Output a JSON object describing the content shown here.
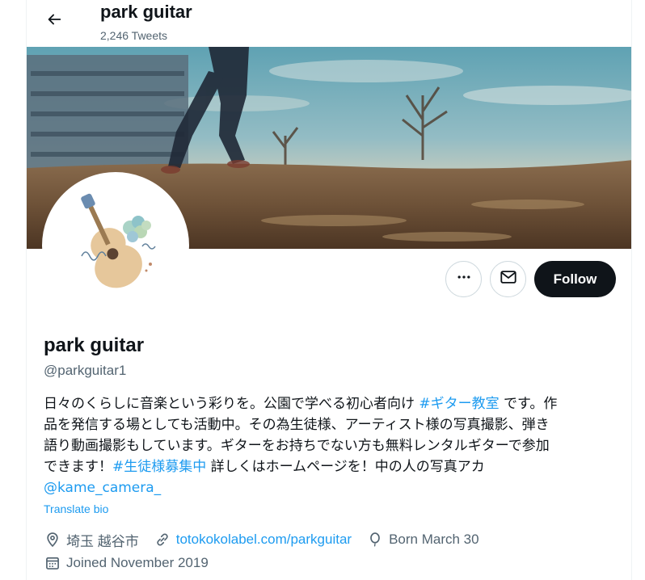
{
  "header": {
    "title": "park guitar",
    "tweet_count": "2,246 Tweets"
  },
  "profile": {
    "display_name": "park guitar",
    "handle": "@parkguitar1",
    "bio": {
      "line1_a": "日々のくらしに音楽という彩りを。公園で学べる初心者向け ",
      "line1_tag": "#ギター教室",
      "line1_b": " です。作",
      "line2": "品を発信する場としても活動中。その為生徒様、アーティスト様の写真撮影、弾き",
      "line3": "語り動画撮影もしています。ギターをお持ちでない方も無料レンタルギターで参加",
      "line4_a": "できます！",
      "line4_tag": "#生徒様募集中",
      "line4_b": " 詳しくはホームページを！中の人の写真アカ",
      "line5_mention": "@kame_camera_"
    },
    "translate_label": "Translate bio",
    "location": "埼玉 越谷市",
    "website": "totokokolabel.com/parkguitar",
    "birthday": "Born March 30",
    "joined": "Joined November 2019"
  },
  "actions": {
    "follow_label": "Follow"
  },
  "icons": {
    "back": "arrow-left-icon",
    "more": "more-dots-icon",
    "message": "envelope-icon",
    "location": "location-pin-icon",
    "link": "link-icon",
    "birthday": "balloon-icon",
    "calendar": "calendar-icon"
  },
  "colors": {
    "accent": "#1d9bf0",
    "text_primary": "#0f1419",
    "text_secondary": "#536471",
    "follow_bg": "#0f1419"
  }
}
